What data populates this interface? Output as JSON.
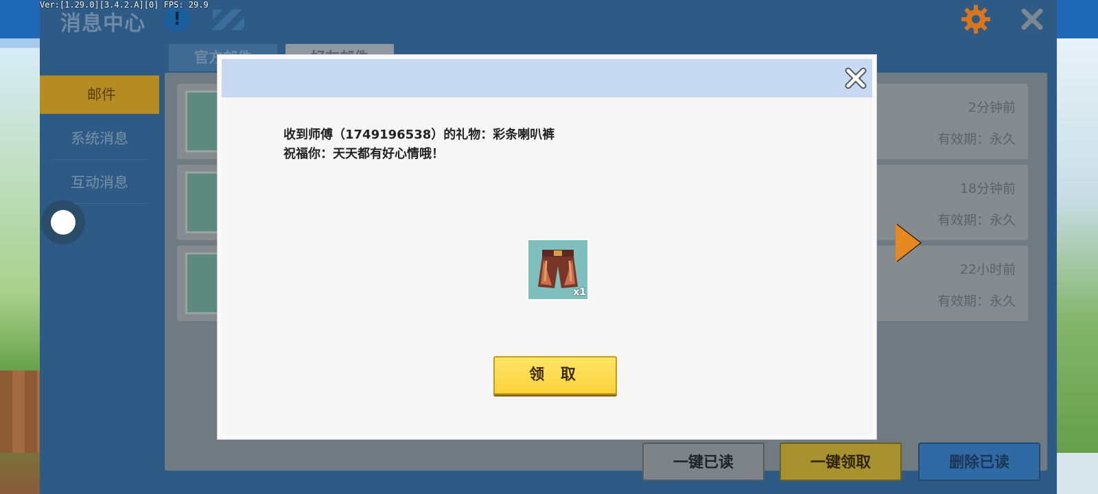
{
  "version_text": "Ver:[1.29.0][3.4.2.A][0] FPS: 29.9",
  "header": {
    "title": "消息中心",
    "info_icon": "info-icon",
    "settings_icon": "gear-icon",
    "close_icon": "close-icon"
  },
  "sidebar": {
    "items": [
      {
        "label": "邮件",
        "active": true
      },
      {
        "label": "系统消息",
        "active": false
      },
      {
        "label": "互动消息",
        "active": false
      }
    ]
  },
  "tabs": [
    {
      "label": "官方邮件"
    },
    {
      "label": "好友邮件"
    }
  ],
  "mails": [
    {
      "time": "2分钟前",
      "validity": "有效期：永久",
      "thumb_icon": "pants-icon"
    },
    {
      "time": "18分钟前",
      "validity": "有效期：永久",
      "thumb_icon": "hammer-icon"
    },
    {
      "time": "22小时前",
      "validity": "有效期：永久",
      "thumb_icon": "avatar-icon"
    }
  ],
  "footer_buttons": {
    "read_all": "一键已读",
    "claim_all": "一键领取",
    "delete_read": "删除已读"
  },
  "modal": {
    "line1": "收到师傅（1749196538）的礼物：彩条喇叭裤",
    "line2": "祝福你：天天都有好心情哦！",
    "gift": {
      "name": "彩条喇叭裤",
      "quantity": "x1",
      "icon": "flared-pants-icon"
    },
    "claim_label": "领 取",
    "close_icon": "close-icon"
  },
  "colors": {
    "accent_yellow": "#fbd33a",
    "modal_header": "#c8d9f2",
    "panel_blue": "#2d5b86",
    "sidebar_active": "#b58b24",
    "arrow_orange": "#e88820"
  }
}
